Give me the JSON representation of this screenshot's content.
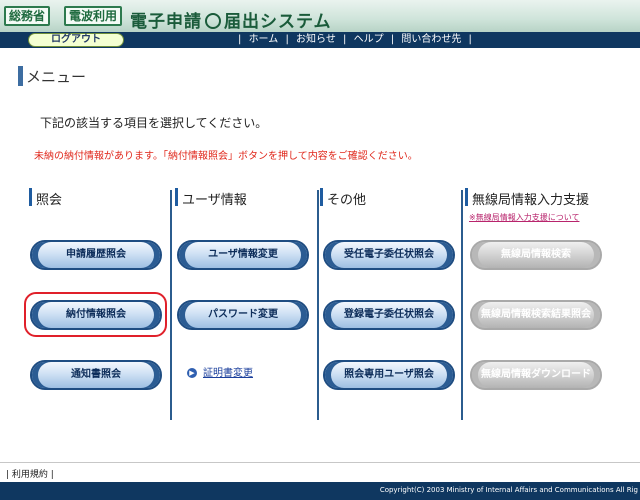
{
  "header": {
    "badge1": "総務省",
    "badge2": "電波利用",
    "system_title_a": "電子申請",
    "system_title_b": "届出システム",
    "logout_label": "ログアウト",
    "nav": [
      "ホーム",
      "お知らせ",
      "ヘルプ",
      "問い合わせ先"
    ]
  },
  "page": {
    "title": "メニュー",
    "instruction": "下記の該当する項目を選択してください。",
    "notice": "未納の納付情報があります。「納付情報照会」ボタンを押して内容をご確認ください。"
  },
  "columns": [
    {
      "heading": "照会",
      "buttons": [
        "申請履歴照会",
        "納付情報照会",
        "通知書照会"
      ]
    },
    {
      "heading": "ユーザ情報",
      "buttons": [
        "ユーザ情報変更",
        "パスワード変更"
      ],
      "link": "証明書変更"
    },
    {
      "heading": "その他",
      "buttons": [
        "受任電子委任状照会",
        "登録電子委任状照会",
        "照会専用ユーザ照会"
      ]
    },
    {
      "heading": "無線局情報入力支援",
      "subnote": "※無線局情報入力支援について",
      "buttons": [
        "無線局情報検索",
        "無線局情報検索結果照会",
        "無線局情報ダウンロード"
      ],
      "disabled": true
    }
  ],
  "footer": {
    "terms": "利用規約",
    "copyright": "Copyright(C) 2003 Ministry of Internal Affairs and Communications All Rig"
  },
  "colors": {
    "nav_bar": "#0f3760",
    "header_bg": "#cfe4da",
    "button_border": "#1f4d82",
    "notice_text": "#e0281c",
    "highlight_circle": "#e0202a"
  },
  "icons": {
    "cert_link_bullet": "right-arrow-circle-icon"
  }
}
